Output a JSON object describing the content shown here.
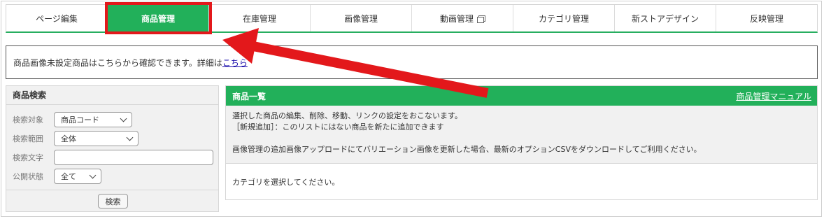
{
  "tabs": [
    {
      "label": "ページ編集",
      "active": false
    },
    {
      "label": "商品管理",
      "active": true
    },
    {
      "label": "在庫管理",
      "active": false
    },
    {
      "label": "画像管理",
      "active": false
    },
    {
      "label": "動画管理",
      "active": false,
      "external_icon": "external-window-icon"
    },
    {
      "label": "カテゴリ管理",
      "active": false
    },
    {
      "label": "新ストアデザイン",
      "active": false
    },
    {
      "label": "反映管理",
      "active": false
    }
  ],
  "notice": {
    "text": "商品画像未設定商品はこちらから確認できます。詳細は",
    "link": "こちら"
  },
  "search": {
    "title": "商品検索",
    "target_label": "検索対象",
    "target_value": "商品コード",
    "range_label": "検索範囲",
    "range_value": "全体",
    "text_label": "検索文字",
    "text_value": "",
    "status_label": "公開状態",
    "status_value": "全て",
    "button_label": "検索"
  },
  "list": {
    "title": "商品一覧",
    "manual_link": "商品管理マニュアル",
    "desc_line1": "選択した商品の編集、削除、移動、リンクの設定をおこないます。",
    "desc_line2": "［新規追加］：このリストにはない商品を新たに追加できます",
    "desc_line3": "画像管理の追加画像アップロードにてバリエーション画像を更新した場合、最新のオプションCSVをダウンロードしてご利用ください。",
    "body_text": "カテゴリを選択してください。"
  },
  "colors": {
    "accent_green": "#22b05a",
    "annotation_red": "#e3181b"
  }
}
